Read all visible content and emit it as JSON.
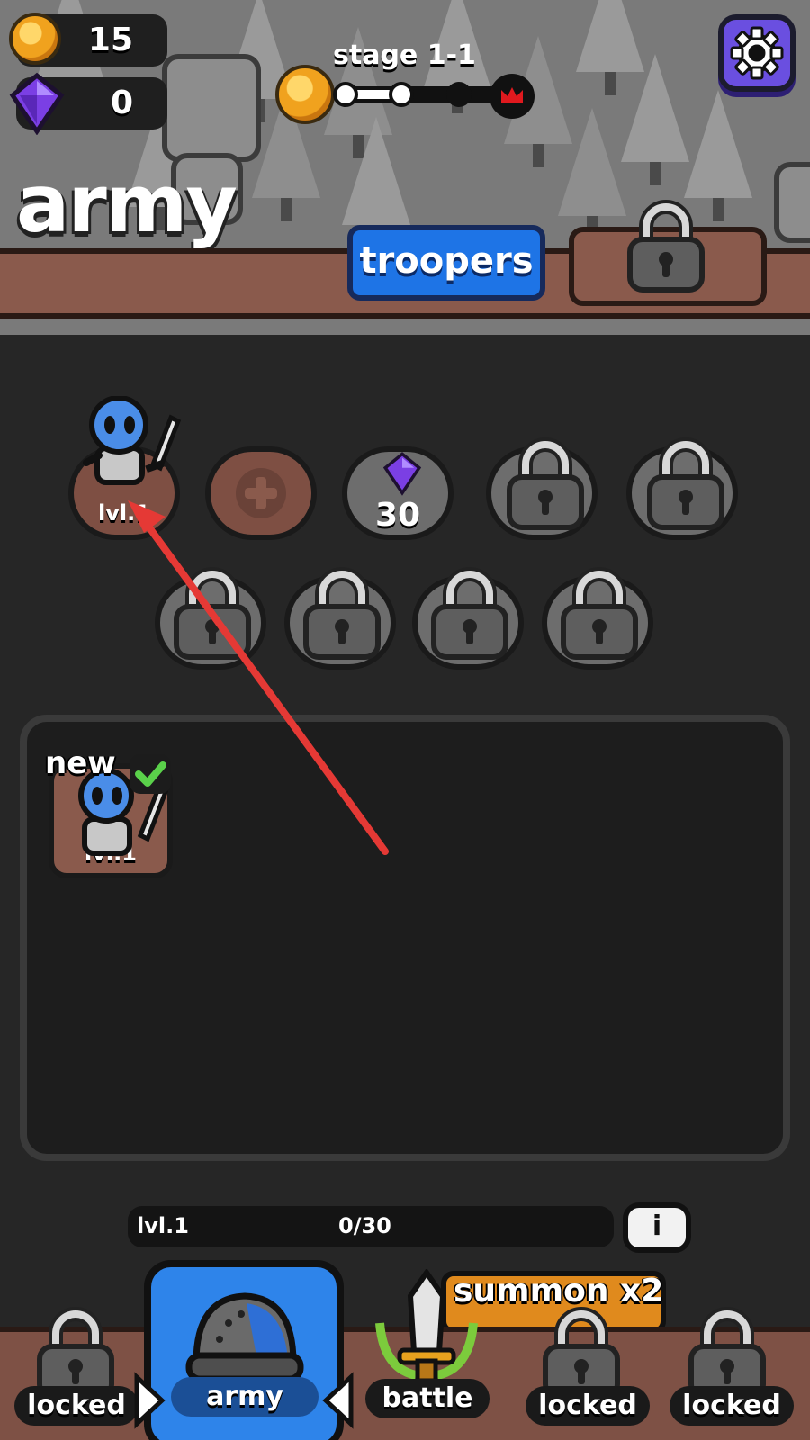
{
  "currency": {
    "gold": "15",
    "gems": "0"
  },
  "stage": {
    "label": "stage 1-1",
    "progress": 0.3
  },
  "page_title": "army",
  "tabs": {
    "active_label": "troopers"
  },
  "roster": {
    "unit_level": "lvl.1",
    "slot_cost": "30"
  },
  "inventory": {
    "new_badge": "new",
    "card_level": "lvl.1"
  },
  "xp": {
    "level": "lvl.1",
    "count": "0/30"
  },
  "info_label": "i",
  "summon": {
    "label": "summon x2"
  },
  "nav": {
    "locked_label": "locked",
    "army_label": "army",
    "battle_label": "battle"
  },
  "colors": {
    "accent_blue": "#2e84ea",
    "guide_arrow": "#e53935",
    "gem_purple": "#7b3fe4",
    "gold": "#f0a21e"
  }
}
